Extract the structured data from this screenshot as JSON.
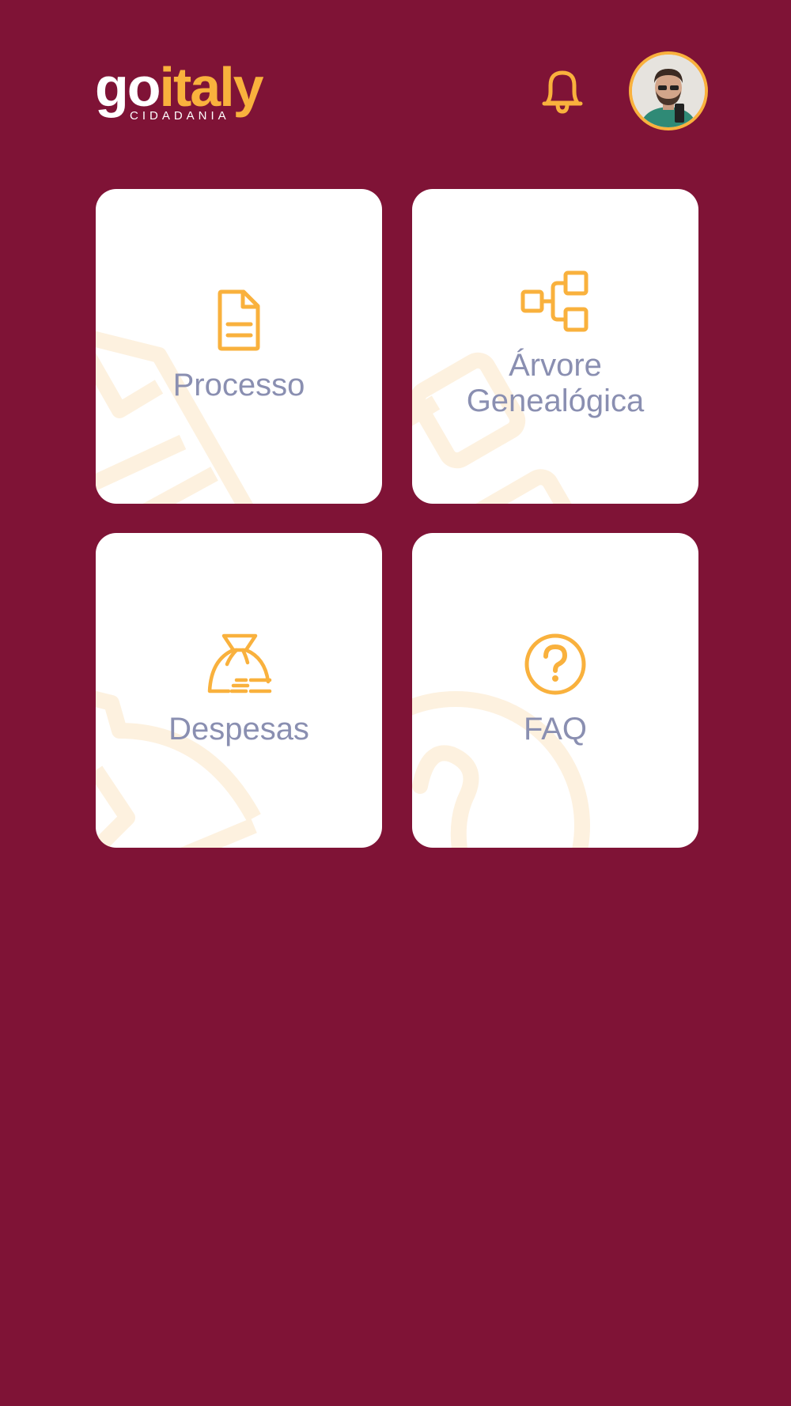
{
  "app": {
    "logo_go": "go",
    "logo_italy": "italy",
    "logo_sub": "CIDADANIA"
  },
  "header": {
    "notifications_icon": "bell-icon",
    "profile_icon": "avatar"
  },
  "colors": {
    "background": "#7f1336",
    "accent": "#f9b13d",
    "card": "#ffffff",
    "label": "#8a8fb1"
  },
  "menu": {
    "items": [
      {
        "label": "Processo",
        "icon": "document-icon"
      },
      {
        "label_line1": "Árvore",
        "label_line2": "Genealógica",
        "icon": "family-tree-icon"
      },
      {
        "label": "Despesas",
        "icon": "money-bag-icon"
      },
      {
        "label": "FAQ",
        "icon": "question-circle-icon"
      }
    ]
  }
}
